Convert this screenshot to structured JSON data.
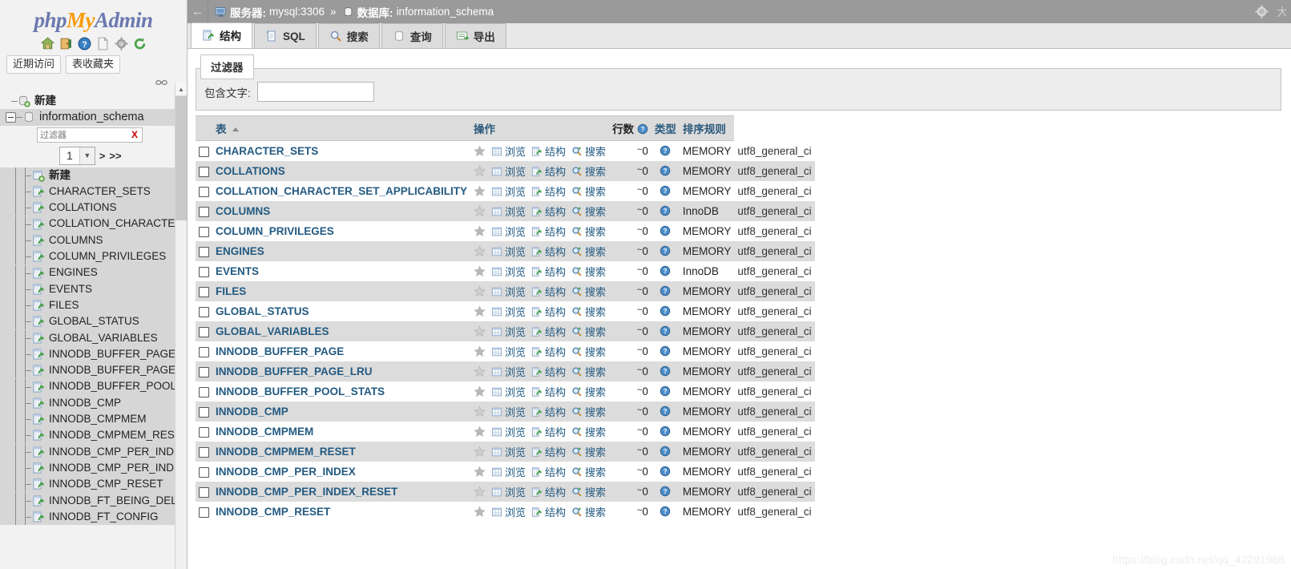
{
  "brand": {
    "php": "php",
    "my": "My",
    "admin": "Admin"
  },
  "sidebar": {
    "icons": [
      {
        "name": "home-icon",
        "title": "主页"
      },
      {
        "name": "logout-icon",
        "title": "退出"
      },
      {
        "name": "help-icon",
        "title": "帮助"
      },
      {
        "name": "docs-icon",
        "title": "文档"
      },
      {
        "name": "settings-icon",
        "title": "设置"
      },
      {
        "name": "refresh-icon",
        "title": "刷新"
      }
    ],
    "quick_links": [
      {
        "label": "近期访问"
      },
      {
        "label": "表收藏夹"
      }
    ],
    "chain_icon": "link-icon",
    "new_db_label": "新建",
    "database_label": "information_schema",
    "filter": {
      "placeholder": "过滤器",
      "value": "",
      "clear_label": "X"
    },
    "pager": {
      "page": "1",
      "next": ">",
      "last": ">>"
    },
    "new_table_label": "新建",
    "tree_items": [
      "CHARACTER_SETS",
      "COLLATIONS",
      "COLLATION_CHARACTER",
      "COLUMNS",
      "COLUMN_PRIVILEGES",
      "ENGINES",
      "EVENTS",
      "FILES",
      "GLOBAL_STATUS",
      "GLOBAL_VARIABLES",
      "INNODB_BUFFER_PAGE",
      "INNODB_BUFFER_PAGE_",
      "INNODB_BUFFER_POOL_",
      "INNODB_CMP",
      "INNODB_CMPMEM",
      "INNODB_CMPMEM_RESE",
      "INNODB_CMP_PER_INDE",
      "INNODB_CMP_PER_INDE",
      "INNODB_CMP_RESET",
      "INNODB_FT_BEING_DELE",
      "INNODB_FT_CONFIG"
    ]
  },
  "topbar": {
    "back_label": "←",
    "server_label": "服务器:",
    "server_value": "mysql:3306",
    "separator": "»",
    "database_label": "数据库:",
    "database_value": "information_schema",
    "gear_icon": "gear-icon"
  },
  "tabs": [
    {
      "label": "结构",
      "icon": "structure-icon",
      "active": true
    },
    {
      "label": "SQL",
      "icon": "sql-icon",
      "active": false
    },
    {
      "label": "搜索",
      "icon": "search-icon",
      "active": false
    },
    {
      "label": "查询",
      "icon": "query-icon",
      "active": false
    },
    {
      "label": "导出",
      "icon": "export-icon",
      "active": false
    }
  ],
  "filter_box": {
    "legend": "过滤器",
    "label": "包含文字:",
    "value": "",
    "placeholder": ""
  },
  "table": {
    "headers": {
      "name": "表",
      "ops": "操作",
      "rows": "行数",
      "type": "类型",
      "collation": "排序规则"
    },
    "ops_labels": {
      "favorite": "收藏",
      "browse": "浏览",
      "structure": "结构",
      "search": "搜索"
    },
    "rows": [
      {
        "name": "CHARACTER_SETS",
        "count": "0",
        "approx": "~",
        "type": "MEMORY",
        "collation": "utf8_general_ci"
      },
      {
        "name": "COLLATIONS",
        "count": "0",
        "approx": "~",
        "type": "MEMORY",
        "collation": "utf8_general_ci"
      },
      {
        "name": "COLLATION_CHARACTER_SET_APPLICABILITY",
        "count": "0",
        "approx": "~",
        "type": "MEMORY",
        "collation": "utf8_general_ci"
      },
      {
        "name": "COLUMNS",
        "count": "0",
        "approx": "~",
        "type": "InnoDB",
        "collation": "utf8_general_ci"
      },
      {
        "name": "COLUMN_PRIVILEGES",
        "count": "0",
        "approx": "~",
        "type": "MEMORY",
        "collation": "utf8_general_ci"
      },
      {
        "name": "ENGINES",
        "count": "0",
        "approx": "~",
        "type": "MEMORY",
        "collation": "utf8_general_ci"
      },
      {
        "name": "EVENTS",
        "count": "0",
        "approx": "~",
        "type": "InnoDB",
        "collation": "utf8_general_ci"
      },
      {
        "name": "FILES",
        "count": "0",
        "approx": "~",
        "type": "MEMORY",
        "collation": "utf8_general_ci"
      },
      {
        "name": "GLOBAL_STATUS",
        "count": "0",
        "approx": "~",
        "type": "MEMORY",
        "collation": "utf8_general_ci"
      },
      {
        "name": "GLOBAL_VARIABLES",
        "count": "0",
        "approx": "~",
        "type": "MEMORY",
        "collation": "utf8_general_ci"
      },
      {
        "name": "INNODB_BUFFER_PAGE",
        "count": "0",
        "approx": "~",
        "type": "MEMORY",
        "collation": "utf8_general_ci"
      },
      {
        "name": "INNODB_BUFFER_PAGE_LRU",
        "count": "0",
        "approx": "~",
        "type": "MEMORY",
        "collation": "utf8_general_ci"
      },
      {
        "name": "INNODB_BUFFER_POOL_STATS",
        "count": "0",
        "approx": "~",
        "type": "MEMORY",
        "collation": "utf8_general_ci"
      },
      {
        "name": "INNODB_CMP",
        "count": "0",
        "approx": "~",
        "type": "MEMORY",
        "collation": "utf8_general_ci"
      },
      {
        "name": "INNODB_CMPMEM",
        "count": "0",
        "approx": "~",
        "type": "MEMORY",
        "collation": "utf8_general_ci"
      },
      {
        "name": "INNODB_CMPMEM_RESET",
        "count": "0",
        "approx": "~",
        "type": "MEMORY",
        "collation": "utf8_general_ci"
      },
      {
        "name": "INNODB_CMP_PER_INDEX",
        "count": "0",
        "approx": "~",
        "type": "MEMORY",
        "collation": "utf8_general_ci"
      },
      {
        "name": "INNODB_CMP_PER_INDEX_RESET",
        "count": "0",
        "approx": "~",
        "type": "MEMORY",
        "collation": "utf8_general_ci"
      },
      {
        "name": "INNODB_CMP_RESET",
        "count": "0",
        "approx": "~",
        "type": "MEMORY",
        "collation": "utf8_general_ci"
      }
    ]
  },
  "watermark": "https://blog.csdn.net/qq_42291968",
  "colors": {
    "link": "#235a81",
    "header_bg": "#9a9a9a",
    "row_alt": "#dcdcdc",
    "brand_orange": "#f89c0e",
    "brand_blue": "#6c78af"
  }
}
